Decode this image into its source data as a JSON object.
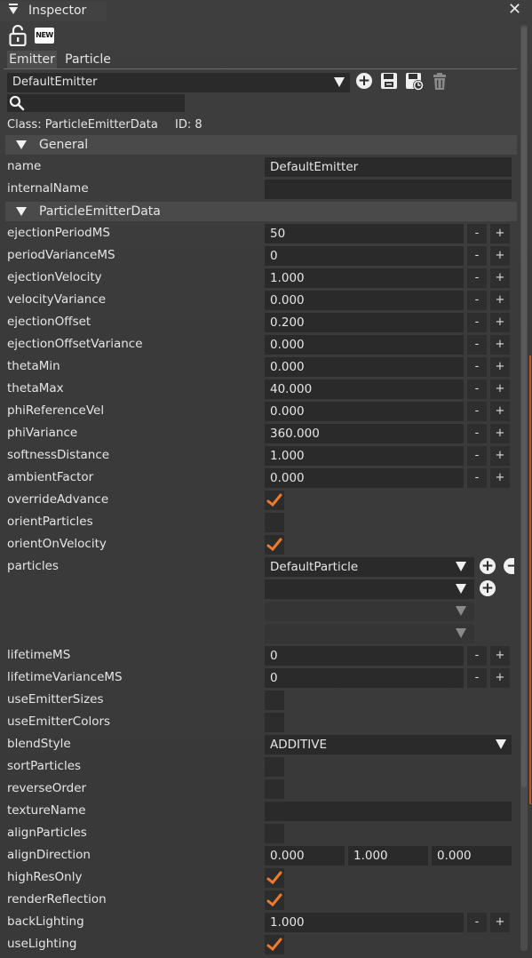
{
  "window": {
    "title": "Inspector"
  },
  "toolbar": {
    "new_label": "NEW"
  },
  "tabs": [
    "Emitter",
    "Particle"
  ],
  "emitter_select": {
    "value": "DefaultEmitter"
  },
  "search": {
    "placeholder": ""
  },
  "info": {
    "class_text": "Class:  ParticleEmitterData",
    "id_text": "ID:  8"
  },
  "sections": {
    "general": "General",
    "emitter": "ParticleEmitterData"
  },
  "general_rows": [
    {
      "label": "name",
      "value": "DefaultEmitter"
    },
    {
      "label": "internalName",
      "value": ""
    }
  ],
  "stepper": {
    "minus": "-",
    "plus": "+"
  },
  "rows": [
    {
      "label": "ejectionPeriodMS",
      "value": "50"
    },
    {
      "label": "periodVarianceMS",
      "value": "0"
    },
    {
      "label": "ejectionVelocity",
      "value": "1.000"
    },
    {
      "label": "velocityVariance",
      "value": "0.000"
    },
    {
      "label": "ejectionOffset",
      "value": "0.200"
    },
    {
      "label": "ejectionOffsetVariance",
      "value": "0.000"
    },
    {
      "label": "thetaMin",
      "value": "0.000"
    },
    {
      "label": "thetaMax",
      "value": "40.000"
    },
    {
      "label": "phiReferenceVel",
      "value": "0.000"
    },
    {
      "label": "phiVariance",
      "value": "360.000"
    },
    {
      "label": "softnessDistance",
      "value": "1.000"
    },
    {
      "label": "ambientFactor",
      "value": "0.000"
    },
    {
      "label": "overrideAdvance",
      "checked": true
    },
    {
      "label": "orientParticles",
      "checked": false
    },
    {
      "label": "orientOnVelocity",
      "checked": true
    },
    {
      "label": "particles",
      "values": [
        "DefaultParticle",
        "",
        "",
        ""
      ]
    },
    {
      "label": "lifetimeMS",
      "value": "0"
    },
    {
      "label": "lifetimeVarianceMS",
      "value": "0"
    },
    {
      "label": "useEmitterSizes",
      "checked": false
    },
    {
      "label": "useEmitterColors",
      "checked": false
    },
    {
      "label": "blendStyle",
      "value": "ADDITIVE"
    },
    {
      "label": "sortParticles",
      "checked": false
    },
    {
      "label": "reverseOrder",
      "checked": false
    },
    {
      "label": "textureName",
      "value": ""
    },
    {
      "label": "alignParticles",
      "checked": false
    },
    {
      "label": "alignDirection",
      "values": [
        "0.000",
        "1.000",
        "0.000"
      ]
    },
    {
      "label": "highResOnly",
      "checked": true
    },
    {
      "label": "renderReflection",
      "checked": true
    },
    {
      "label": "backLighting",
      "value": "1.000"
    },
    {
      "label": "useLighting",
      "checked": true
    }
  ],
  "colors": {
    "accent": "#ef7a2b",
    "field_bg": "#2a2a2a",
    "section_bg": "#4a4a4a"
  },
  "icons": [
    "hamburger-triangle-icon",
    "close-icon",
    "unlock-icon",
    "new-icon",
    "add-icon",
    "save-icon",
    "save-as-icon",
    "delete-icon",
    "search-icon",
    "remove-icon",
    "check-icon",
    "dropdown-caret-icon"
  ]
}
